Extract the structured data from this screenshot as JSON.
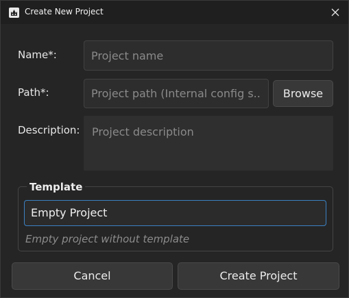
{
  "window": {
    "title": "Create New Project"
  },
  "form": {
    "name_label": "Name*:",
    "name_placeholder": "Project name",
    "name_value": "",
    "path_label": "Path*:",
    "path_placeholder": "Project path (Internal config s...",
    "path_value": "",
    "browse_label": "Browse",
    "description_label": "Description:",
    "description_placeholder": "Project description",
    "description_value": ""
  },
  "template": {
    "group_title": "Template",
    "selected": "Empty Project",
    "description": "Empty project without template"
  },
  "actions": {
    "cancel_label": "Cancel",
    "create_label": "Create Project"
  },
  "colors": {
    "background": "#252525",
    "field": "#2d2d2d",
    "accent_focus": "#3b82c4",
    "button": "#383838",
    "placeholder": "#8a8a8a"
  }
}
